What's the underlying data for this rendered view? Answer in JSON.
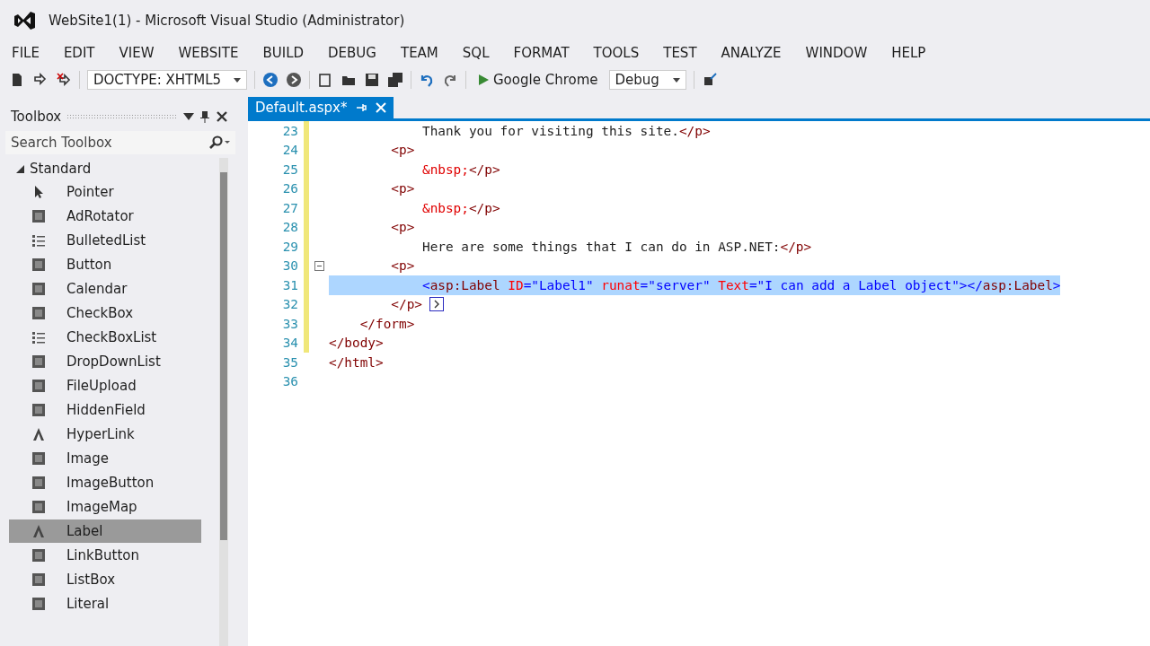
{
  "window": {
    "title": "WebSite1(1) - Microsoft Visual Studio (Administrator)"
  },
  "menu": [
    "FILE",
    "EDIT",
    "VIEW",
    "WEBSITE",
    "BUILD",
    "DEBUG",
    "TEAM",
    "SQL",
    "FORMAT",
    "TOOLS",
    "TEST",
    "ANALYZE",
    "WINDOW",
    "HELP"
  ],
  "toolbar": {
    "doctype": "DOCTYPE: XHTML5",
    "browser": "Google Chrome",
    "configuration": "Debug"
  },
  "toolbox": {
    "title": "Toolbox",
    "search": {
      "placeholder": "Search Toolbox"
    },
    "group": {
      "label": "Standard",
      "expanded": true
    },
    "items": [
      {
        "label": "Pointer",
        "kind": "pointer",
        "selected": false
      },
      {
        "label": "AdRotator",
        "kind": "control",
        "selected": false
      },
      {
        "label": "BulletedList",
        "kind": "list",
        "selected": false
      },
      {
        "label": "Button",
        "kind": "control",
        "selected": false
      },
      {
        "label": "Calendar",
        "kind": "control",
        "selected": false
      },
      {
        "label": "CheckBox",
        "kind": "control",
        "selected": false
      },
      {
        "label": "CheckBoxList",
        "kind": "list",
        "selected": false
      },
      {
        "label": "DropDownList",
        "kind": "control",
        "selected": false
      },
      {
        "label": "FileUpload",
        "kind": "control",
        "selected": false
      },
      {
        "label": "HiddenField",
        "kind": "control",
        "selected": false
      },
      {
        "label": "HyperLink",
        "kind": "text",
        "selected": false
      },
      {
        "label": "Image",
        "kind": "control",
        "selected": false
      },
      {
        "label": "ImageButton",
        "kind": "control",
        "selected": false
      },
      {
        "label": "ImageMap",
        "kind": "control",
        "selected": false
      },
      {
        "label": "Label",
        "kind": "text",
        "selected": true
      },
      {
        "label": "LinkButton",
        "kind": "control",
        "selected": false
      },
      {
        "label": "ListBox",
        "kind": "control",
        "selected": false
      },
      {
        "label": "Literal",
        "kind": "control",
        "selected": false
      }
    ]
  },
  "editor": {
    "tab": {
      "label": "Default.aspx*",
      "selected": true
    },
    "lines": [
      {
        "number": "23",
        "selected": false,
        "tokens": [
          {
            "kind": "plain",
            "text": "            Thank you for visiting this site."
          },
          {
            "kind": "tag",
            "text": "</p>"
          }
        ]
      },
      {
        "number": "24",
        "selected": false,
        "tokens": [
          {
            "kind": "tag",
            "text": "        <p>"
          }
        ]
      },
      {
        "number": "25",
        "selected": false,
        "tokens": [
          {
            "kind": "entity",
            "text": "            &nbsp;"
          },
          {
            "kind": "tag",
            "text": "</p>"
          }
        ]
      },
      {
        "number": "26",
        "selected": false,
        "tokens": [
          {
            "kind": "tag",
            "text": "        <p>"
          }
        ]
      },
      {
        "number": "27",
        "selected": false,
        "tokens": [
          {
            "kind": "entity",
            "text": "            &nbsp;"
          },
          {
            "kind": "tag",
            "text": "</p>"
          }
        ]
      },
      {
        "number": "28",
        "selected": false,
        "tokens": [
          {
            "kind": "tag",
            "text": "        <p>"
          }
        ]
      },
      {
        "number": "29",
        "selected": false,
        "tokens": [
          {
            "kind": "plain",
            "text": "            Here are some things that I can do in ASP.NET:"
          },
          {
            "kind": "tag",
            "text": "</p>"
          }
        ]
      },
      {
        "number": "30",
        "selected": false,
        "tokens": [
          {
            "kind": "tag",
            "text": "        <p>"
          }
        ]
      },
      {
        "number": "31",
        "selected": true,
        "tokens": [
          {
            "kind": "punct",
            "text": "            <"
          },
          {
            "kind": "element",
            "text": "asp:Label"
          },
          {
            "kind": "attr",
            "text": " ID"
          },
          {
            "kind": "punct",
            "text": "=\"Label1\""
          },
          {
            "kind": "attr",
            "text": " runat"
          },
          {
            "kind": "punct",
            "text": "=\"server\""
          },
          {
            "kind": "attr",
            "text": " Text"
          },
          {
            "kind": "punct",
            "text": "=\"I can add a Label object\"></"
          },
          {
            "kind": "element",
            "text": "asp:Label"
          },
          {
            "kind": "punct",
            "text": ">"
          }
        ]
      },
      {
        "number": "32",
        "selected": false,
        "tokens": [
          {
            "kind": "tag",
            "text": "        </p>"
          }
        ]
      },
      {
        "number": "33",
        "selected": false,
        "tokens": [
          {
            "kind": "tag",
            "text": "    </form>"
          }
        ]
      },
      {
        "number": "34",
        "selected": false,
        "tokens": [
          {
            "kind": "tag",
            "text": "</body>"
          }
        ]
      },
      {
        "number": "35",
        "selected": false,
        "tokens": [
          {
            "kind": "tag",
            "text": "</html>"
          }
        ]
      },
      {
        "number": "36",
        "selected": false
      }
    ]
  }
}
